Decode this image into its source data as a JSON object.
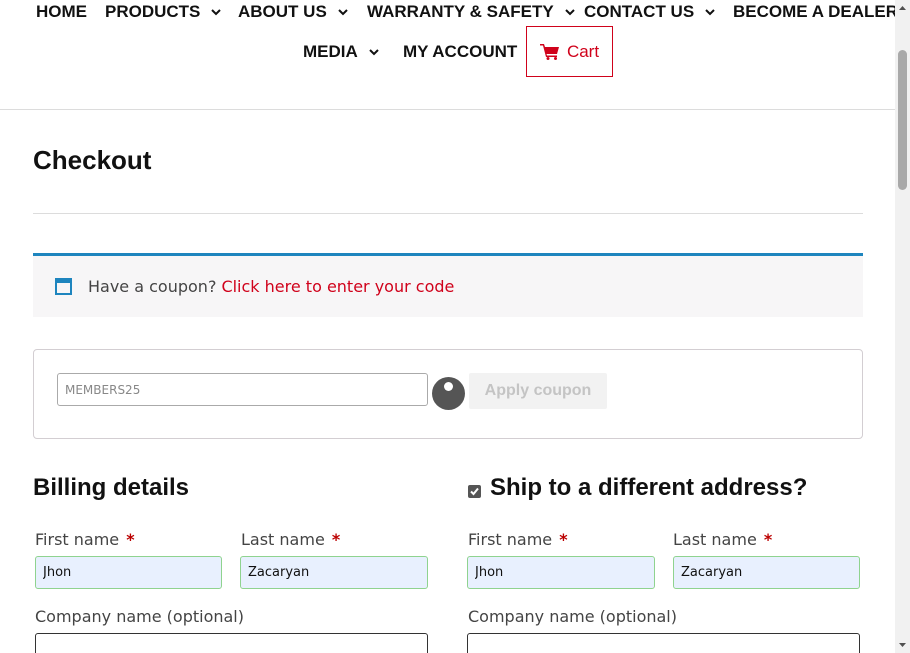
{
  "nav": {
    "row1": [
      {
        "label": "HOME",
        "dropdown": false
      },
      {
        "label": "PRODUCTS",
        "dropdown": true
      },
      {
        "label": "ABOUT US",
        "dropdown": true
      },
      {
        "label": "WARRANTY & SAFETY",
        "dropdown": true
      },
      {
        "label": "CONTACT US",
        "dropdown": true
      },
      {
        "label": "BECOME A DEALER",
        "dropdown": false
      }
    ],
    "row2": [
      {
        "label": "MEDIA",
        "dropdown": true
      },
      {
        "label": "MY ACCOUNT",
        "dropdown": false
      }
    ],
    "cart_label": "Cart"
  },
  "page": {
    "title": "Checkout"
  },
  "coupon": {
    "notice_text": "Have a coupon?",
    "notice_link": "Click here to enter your code",
    "input_placeholder": "MEMBERS25",
    "apply_label": "Apply coupon"
  },
  "billing": {
    "title": "Billing details",
    "first_name_label": "First name",
    "first_name_value": "Jhon",
    "last_name_label": "Last name",
    "last_name_value": "Zacaryan",
    "company_label": "Company name (optional)",
    "required_mark": "*"
  },
  "shipping": {
    "title": "Ship to a different address?",
    "checked": true,
    "first_name_label": "First name",
    "first_name_value": "Jhon",
    "last_name_label": "Last name",
    "last_name_value": "Zacaryan",
    "company_label": "Company name (optional)",
    "required_mark": "*"
  },
  "colors": {
    "accent_red": "#d0021b",
    "notice_blue": "#1e85be",
    "autofill_bg": "#e8f0fe",
    "autofill_border": "#8fd38f"
  }
}
